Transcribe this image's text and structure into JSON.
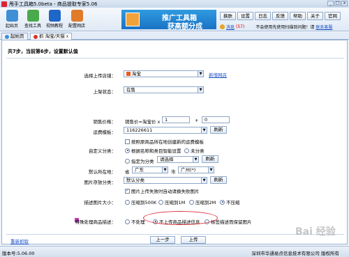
{
  "window": {
    "title": "甩手工具箱5.0beta - 商品提取专家5.06",
    "controls": [
      "_",
      "□",
      "x"
    ]
  },
  "toolbar": {
    "items": [
      {
        "label": "起始页",
        "icon": "home-icon",
        "color": "#3f8fd6"
      },
      {
        "label": "查找工具",
        "icon": "find-tool-icon",
        "color": "#4aa94c"
      },
      {
        "label": "视频教程",
        "icon": "video-icon",
        "color": "#1e66c8"
      },
      {
        "label": "配置网店",
        "icon": "shop-config-icon",
        "color": "#e07b2a"
      }
    ]
  },
  "banner": {
    "line1": "推广工具箱",
    "line2": "获高额分成"
  },
  "menu": [
    "换肤",
    "设置",
    "日志",
    "反馈",
    "帮助",
    "关于",
    "官网"
  ],
  "messages": {
    "label": "消息",
    "count": "(57)",
    "notice": "不会使用先使用扫描到问题！请",
    "contact": "联系客服"
  },
  "tabs": [
    {
      "label": "起始页",
      "icon_color": "#3f8fd6"
    },
    {
      "label": "抓 淘宝/天猫",
      "icon_color": "#d8332a"
    }
  ],
  "step_title": "共7步，当前第6步，设置默认值",
  "form": {
    "shop_label": "选择上传店铺：",
    "shop_value": "淘宝",
    "new_shop_link": "新增网店",
    "status_label": "上架状态：",
    "status_value": "在售",
    "price_label": "销售价格：",
    "price_prefix": "销售价=淘宝价 x",
    "price_multiplier": "1",
    "price_plus": "+",
    "price_add": "0",
    "shipping_label": "运费模板：",
    "shipping_value": "116226611",
    "refresh": "刷新",
    "shipping_check": "按照原商品所在地创建新的运费模板",
    "category_label": "自定义分类：",
    "cat_opt1": "根据名称和类目智能设置",
    "cat_opt2": "未分类",
    "cat_opt3": "指定为分类",
    "cat_select": "请选择",
    "location_label": "默认所在地：",
    "province_prefix": "省",
    "province": "广东",
    "city_prefix": "市",
    "city": "广州(*)",
    "image_cat_label": "图片存放分类：",
    "image_cat": "默认分类",
    "image_check": "图片上传失败时自动请换失败图片",
    "compress_label": "描述图片大小：",
    "compress_opts": [
      "压缩到500K",
      "压缩到1M",
      "压缩到2M",
      "不压缩"
    ],
    "special_label": "特殊处理商品描述：",
    "special_opts": [
      "不处理",
      "不上传商品描述信息",
      "标签描述而保留图片"
    ]
  },
  "footer": {
    "reset_link": "重新抓取",
    "prev": "上一步",
    "next": "上传"
  },
  "status": {
    "version": "版本号:5.06.00",
    "copyright": "深圳市华通易点信息技术有限公司 版权所有"
  },
  "watermark": "Bai 经验"
}
